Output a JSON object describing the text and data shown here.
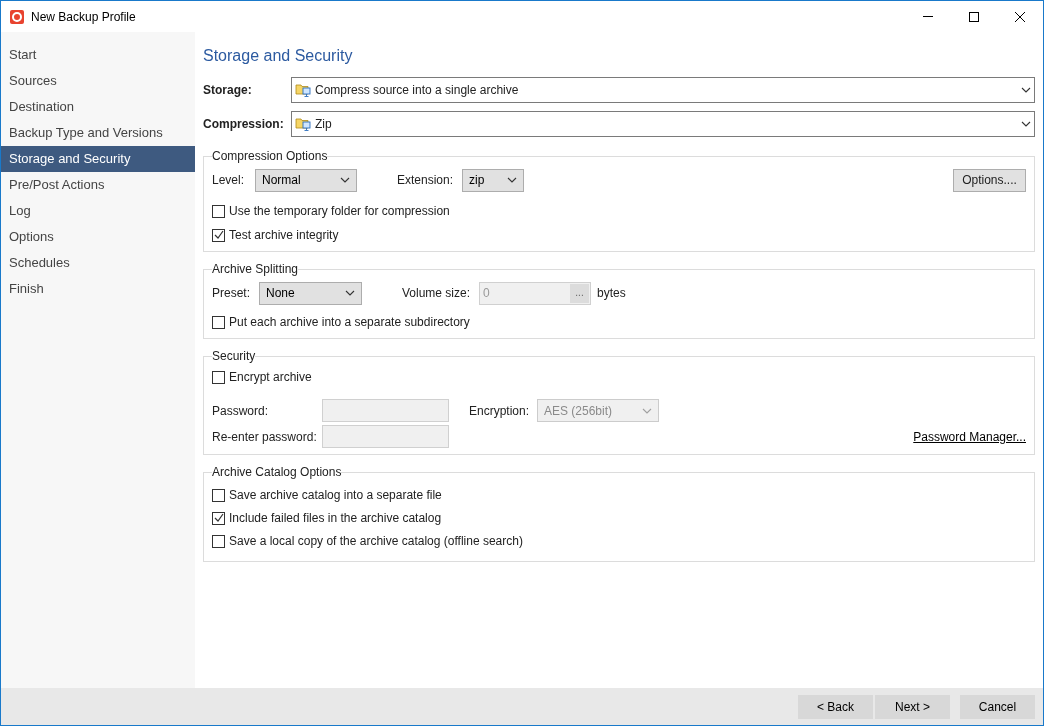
{
  "window": {
    "title": "New Backup Profile"
  },
  "sidebar": {
    "items": [
      {
        "label": "Start",
        "selected": false
      },
      {
        "label": "Sources",
        "selected": false
      },
      {
        "label": "Destination",
        "selected": false
      },
      {
        "label": "Backup Type and Versions",
        "selected": false
      },
      {
        "label": "Storage and Security",
        "selected": true
      },
      {
        "label": "Pre/Post Actions",
        "selected": false
      },
      {
        "label": "Log",
        "selected": false
      },
      {
        "label": "Options",
        "selected": false
      },
      {
        "label": "Schedules",
        "selected": false
      },
      {
        "label": "Finish",
        "selected": false
      }
    ]
  },
  "heading": "Storage and Security",
  "storage": {
    "label": "Storage:",
    "value": "Compress source into a single archive"
  },
  "compression": {
    "label": "Compression:",
    "value": "Zip"
  },
  "compression_options": {
    "title": "Compression Options",
    "level_label": "Level:",
    "level": "Normal",
    "extension_label": "Extension:",
    "extension": "zip",
    "options_button": "Options....",
    "checkboxes": [
      {
        "label": "Use the temporary folder for compression",
        "checked": false
      },
      {
        "label": "Test archive integrity",
        "checked": true
      }
    ]
  },
  "archive_splitting": {
    "title": "Archive Splitting",
    "preset_label": "Preset:",
    "preset": "None",
    "volume_label": "Volume size:",
    "volume_value": "0",
    "volume_disabled": true,
    "browse_button": "...",
    "unit": "bytes",
    "checkboxes": [
      {
        "label": "Put each archive into a separate subdirectory",
        "checked": false
      }
    ]
  },
  "security": {
    "title": "Security",
    "checkboxes": [
      {
        "label": "Encrypt archive",
        "checked": false
      }
    ],
    "password_label": "Password:",
    "reenter_label": "Re-enter password:",
    "password_disabled": true,
    "encryption_label": "Encryption:",
    "encryption": "AES (256bit)",
    "encryption_disabled": true,
    "password_manager": "Password Manager..."
  },
  "catalog": {
    "title": "Archive Catalog Options",
    "checkboxes": [
      {
        "label": "Save archive catalog into a separate file",
        "checked": false
      },
      {
        "label": "Include failed files in the archive catalog",
        "checked": true
      },
      {
        "label": "Save a local copy of the archive catalog (offline search)",
        "checked": false
      }
    ]
  },
  "footer": {
    "buttons": [
      "< Back",
      "Next >",
      "Cancel"
    ]
  }
}
